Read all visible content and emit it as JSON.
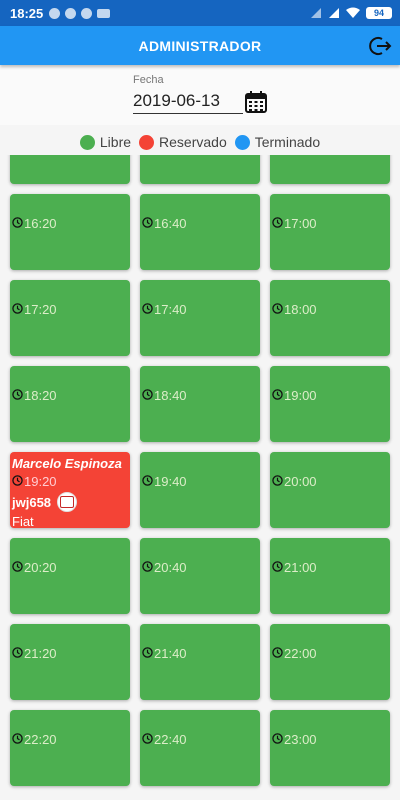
{
  "status_bar": {
    "time": "18:25",
    "battery": "94"
  },
  "app_bar": {
    "title": "ADMINISTRADOR",
    "logout_icon": "logout-icon"
  },
  "date_picker": {
    "label": "Fecha",
    "value": "2019-06-13",
    "icon": "calendar-icon"
  },
  "legend": [
    {
      "label": "Libre",
      "color": "#4caf50"
    },
    {
      "label": "Reservado",
      "color": "#f44336"
    },
    {
      "label": "Terminado",
      "color": "#2196f3"
    }
  ],
  "slots": [
    {
      "time": "",
      "status": "libre"
    },
    {
      "time": "",
      "status": "libre"
    },
    {
      "time": "",
      "status": "libre"
    },
    {
      "time": "16:20",
      "status": "libre"
    },
    {
      "time": "16:40",
      "status": "libre"
    },
    {
      "time": "17:00",
      "status": "libre"
    },
    {
      "time": "17:20",
      "status": "libre"
    },
    {
      "time": "17:40",
      "status": "libre"
    },
    {
      "time": "18:00",
      "status": "libre"
    },
    {
      "time": "18:20",
      "status": "libre"
    },
    {
      "time": "18:40",
      "status": "libre"
    },
    {
      "time": "19:00",
      "status": "libre"
    },
    {
      "time": "19:20",
      "status": "reservado",
      "client": "Marcelo Espinoza",
      "plate": "jwj658",
      "car": "Fiat"
    },
    {
      "time": "19:40",
      "status": "libre"
    },
    {
      "time": "20:00",
      "status": "libre"
    },
    {
      "time": "20:20",
      "status": "libre"
    },
    {
      "time": "20:40",
      "status": "libre"
    },
    {
      "time": "21:00",
      "status": "libre"
    },
    {
      "time": "21:20",
      "status": "libre"
    },
    {
      "time": "21:40",
      "status": "libre"
    },
    {
      "time": "22:00",
      "status": "libre"
    },
    {
      "time": "22:20",
      "status": "libre"
    },
    {
      "time": "22:40",
      "status": "libre"
    },
    {
      "time": "23:00",
      "status": "libre"
    }
  ]
}
